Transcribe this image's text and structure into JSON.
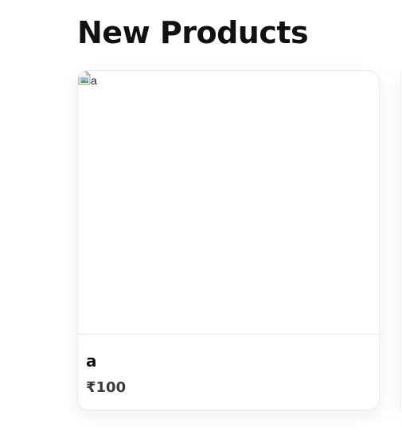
{
  "section": {
    "title": "New Products"
  },
  "products": [
    {
      "image_alt": "a",
      "name": "a",
      "price": "₹100"
    }
  ],
  "icons": {
    "broken_image": "broken-image-icon"
  }
}
